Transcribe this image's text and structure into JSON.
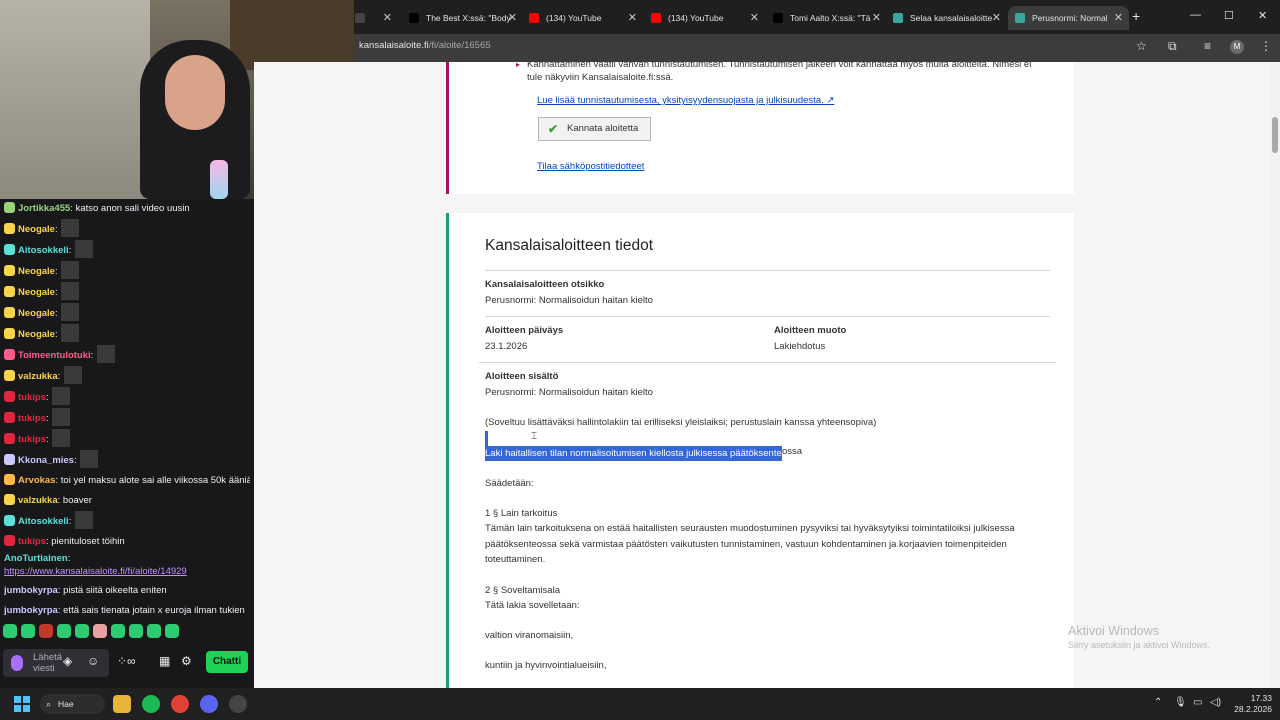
{
  "chat": {
    "messages": [
      {
        "user": "Jortikka455",
        "text": "katso anon sali video uusin",
        "color": "#9ad27c",
        "emotes": 0
      },
      {
        "user": "Neogale",
        "text": "",
        "color": "#f7d44a",
        "emotes": 1
      },
      {
        "user": "Aitosokkeli",
        "text": "",
        "color": "#5ce0d8",
        "emotes": 1
      },
      {
        "user": "Neogale",
        "text": "",
        "color": "#f7d44a",
        "emotes": 1
      },
      {
        "user": "Neogale",
        "text": "",
        "color": "#f7d44a",
        "emotes": 1
      },
      {
        "user": "Neogale",
        "text": "",
        "color": "#f7d44a",
        "emotes": 1
      },
      {
        "user": "Neogale",
        "text": "",
        "color": "#f7d44a",
        "emotes": 1
      },
      {
        "user": "Toimeentulotuki",
        "text": "",
        "color": "#ff5c8a",
        "emotes": 1
      },
      {
        "user": "valzukka",
        "text": "",
        "color": "#f7d44a",
        "emotes": 1
      },
      {
        "user": "tukips",
        "text": "",
        "color": "#e0263e",
        "emotes": 1
      },
      {
        "user": "tukips",
        "text": "",
        "color": "#e0263e",
        "emotes": 1
      },
      {
        "user": "tukips",
        "text": "",
        "color": "#e0263e",
        "emotes": 1
      },
      {
        "user": "Kkona_mies",
        "text": "",
        "color": "#c8c8ff",
        "emotes": 1
      },
      {
        "user": "Arvokas",
        "text": "toi yel maksu alote sai alle viikossa 50k ääniä",
        "color": "#ffb84a",
        "emotes": 0
      },
      {
        "user": "valzukka",
        "text": "boaver",
        "color": "#f7d44a",
        "emotes": 0
      },
      {
        "user": "Aitosokkeli",
        "text": "",
        "color": "#5ce0d8",
        "emotes": 1
      },
      {
        "user": "tukips",
        "text": "pienituloset töihin",
        "color": "#e0263e",
        "emotes": 0
      }
    ],
    "link_user": "AnoTurtiainen",
    "link_text": "https://www.kansalaisaloite.fi/fi/aloite/14929",
    "msg_jumbo1_user": "jumbokyrpa",
    "msg_jumbo1_text": "pistä siitä oikeelta eniten",
    "msg_jumbo2_user": "jumbokyrpa",
    "msg_jumbo2_text": "että sais tienata jotain x euroja ilman tukien lähtemistä",
    "input_placeholder": "Lähetä viesti",
    "chat_button": "Chatti"
  },
  "browser": {
    "tabs": [
      {
        "title": "",
        "icon": "x-logo-icon",
        "color": "#444"
      },
      {
        "title": "The Best X:ssä: \"Body",
        "icon": "x-logo-icon",
        "color": "#000"
      },
      {
        "title": "(134) YouTube",
        "icon": "youtube-icon",
        "color": "#ff0000"
      },
      {
        "title": "(134) YouTube",
        "icon": "youtube-icon",
        "color": "#ff0000"
      },
      {
        "title": "Tomi Aalto X:ssä: \"Tä",
        "icon": "x-logo-icon",
        "color": "#000"
      },
      {
        "title": "Selaa kansalaisaloitte",
        "icon": "site-icon",
        "color": "#3aa6a0"
      },
      {
        "title": "Perusnormi: Normal",
        "icon": "site-icon",
        "color": "#3aa6a0"
      }
    ],
    "url_host": "kansalaisaloite.fi",
    "url_path": "/fi/aloite/16565",
    "avatar_letter": "M"
  },
  "page": {
    "card1": {
      "notice": "Kannattaminen vaatii vahvan tunnistautumisen. Tunnistautumisen jälkeen voit kannattaa myös muita aloitteita. Nimesi ei tule näkyviin Kansalaisaloite.fi:ssä.",
      "info_link": "Lue lisää tunnistautumisesta, yksityisyydensuojasta ja julkisuudesta.",
      "support_button": "Kannata aloitetta",
      "subscribe_link": "Tilaa sähköpostitiedotteet"
    },
    "card2": {
      "title": "Kansalaisaloitteen tiedot",
      "title_label": "Kansalaisaloitteen otsikko",
      "title_value": "Perusnormi: Normalisoidun haitan kielto",
      "date_label": "Aloitteen päiväys",
      "date_value": "23.1.2026",
      "form_label": "Aloitteen muoto",
      "form_value": "Lakiehdotus",
      "content_label": "Aloitteen sisältö",
      "content_value": "Perusnormi: Normalisoidun haitan kielto",
      "note": "(Soveltuu lisättäväksi hallintolakiin tai erilliseksi yleislaiksi; perustuslain kanssa yhteensopiva)",
      "law_title_selected": "Laki haitallisen tilan normalisoitumisen kiellosta julkisessa päätöksente",
      "law_title_rest": "ossa",
      "saadetaan": "Säädetään:",
      "s1_head": "1 § Lain tarkoitus",
      "s1_body": "Tämän lain tarkoituksena on estää haitallisten seurausten muodostuminen pysyviksi tai hyväksytyiksi toimintatiloiksi julkisessa päätöksenteossa sekä varmistaa päätösten vaikutusten tunnistaminen, vastuun kohdentaminen ja korjaavien toimenpiteiden toteuttaminen.",
      "s2_head": "2 § Soveltamisala",
      "s2_body": "Tätä lakia sovelletaan:",
      "item1": "valtion viranomaisiin,",
      "item2": "kuntiin ja hyvinvointialueisiin,"
    },
    "watermark_title": "Aktivoi Windows",
    "watermark_sub": "Siirry asetuksiin ja aktivoi Windows."
  },
  "taskbar": {
    "search_label": "Hae",
    "time": "17.33",
    "date": "28.2.2026"
  }
}
